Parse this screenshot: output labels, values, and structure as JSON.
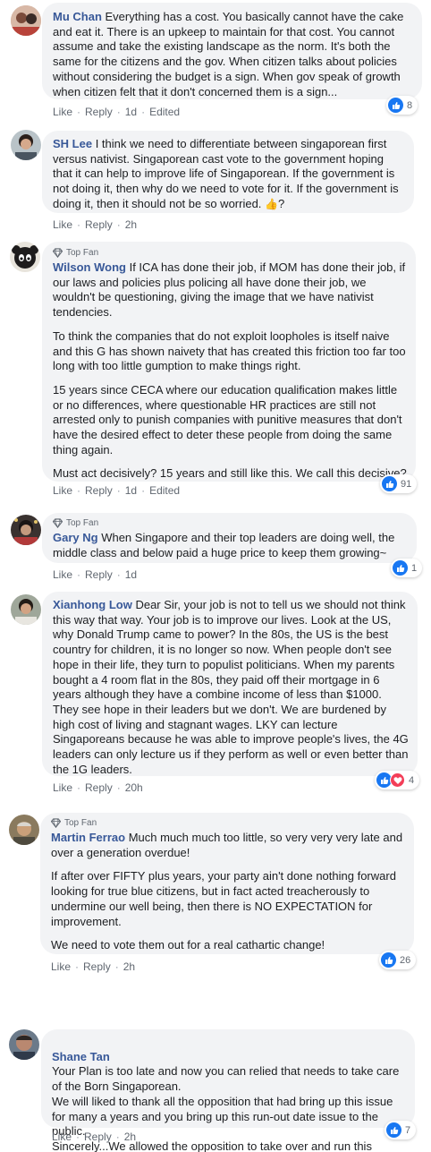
{
  "actions": {
    "like": "Like",
    "reply": "Reply",
    "sep": "·",
    "edited": "Edited"
  },
  "comments": [
    {
      "author": "Mu Chan",
      "paragraphs": [
        "Everything has a cost. You basically cannot have the cake and eat it. There is an upkeep to maintain for that cost. You cannot assume and take the existing landscape as the norm. It's both the same for the citizens and the gov. When citizen talks about policies without considering the budget is a sign. When gov speak of growth when citizen felt that it don't concerned them is a sign..."
      ],
      "time": "1d",
      "reaction_count": "8"
    },
    {
      "author": "SH Lee",
      "paragraphs": [
        "I think we need to differentiate between singaporean first versus nativist. Singaporean cast vote to the government hoping that it can help to improve life of Singaporean. If the government is not doing it, then why do we need to vote for it. If the government is doing it, then it should not be so worried.",
        "?"
      ],
      "emoji": "👍",
      "time": "2h"
    },
    {
      "badge": "Top Fan",
      "author": "Wilson Wong",
      "paragraphs": [
        "If ICA has done their job, if MOM has done their job, if our laws and policies plus policing all have done their job, we wouldn't be questioning, giving the image that we have nativist tendencies.",
        "To think the companies that do not exploit loopholes is itself naive and this G has shown naivety that has created this friction too far too long with too little gumption to make things right.",
        "15 years since CECA where our education qualification makes little or no differences, where questionable HR practices are still not arrested only to punish companies with punitive measures that don't have the desired effect to deter these people from doing the same thing again.",
        "Must act decisively? 15 years and still like this. We call this decisive?"
      ],
      "time": "1d",
      "reaction_count": "91"
    },
    {
      "badge": "Top Fan",
      "author": "Gary Ng",
      "paragraphs": [
        "When Singapore and their top leaders are doing well, the middle class and below paid a huge price to keep them growing~"
      ],
      "time": "1d",
      "reaction_count": "1"
    },
    {
      "author": "Xianhong Low",
      "paragraphs": [
        "Dear Sir, your job is not to tell us we should not think this way that way. Your job is to improve our lives. Look at the US, why Donald Trump came to power? In the 80s, the US is the best country for children, it is no longer so now. When people don't see hope in their life, they turn to populist politicians. When my parents bought a 4 room flat in the 80s, they paid off their mortgage in 6 years although they have a combine income of less than $1000. They see hope in their leaders but we don't. We are burdened by high cost of living and stagnant wages. LKY can lecture Singaporeans because he was able to improve people's lives, the 4G leaders can only lecture us if they perform as well or even better than the 1G leaders."
      ],
      "time": "20h",
      "reaction_count": "4"
    },
    {
      "badge": "Top Fan",
      "author": "Martin Ferrao",
      "paragraphs": [
        "Much much much too little, so very very very late and over a generation overdue!",
        "If after over FIFTY plus years, your party ain't done nothing forward looking for true blue citizens, but in fact acted treacherously to undermine our well being, then there is NO EXPECTATION for improvement.",
        "We need to vote them out for a real cathartic change!"
      ],
      "time": "2h",
      "reaction_count": "26"
    },
    {
      "author": "Shane Tan",
      "paragraphs": [
        "Your Plan is too late and now you can relied that needs to take care of the Born Singaporean.\nWe will liked to thank all the opposition that had bring up this issue for many a years and you bring up this run-out date issue to the public.\nSincerely...We allowed the opposition to take over and run this country strictly belong to all Born Singapore."
      ],
      "time": "2h",
      "reaction_count": "7"
    }
  ]
}
